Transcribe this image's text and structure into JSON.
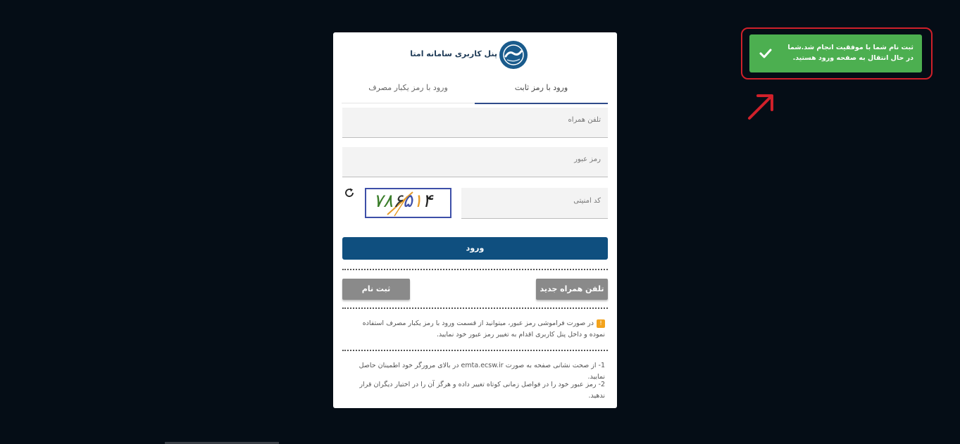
{
  "brand": {
    "title": "پنل کاربری سامانه امتا",
    "logo_icon": "emta-logo"
  },
  "tabs": [
    {
      "label": "ورود با رمز ثابت",
      "active": true
    },
    {
      "label": "ورود با رمز یکبار مصرف",
      "active": false
    }
  ],
  "form": {
    "phone_placeholder": "تلفن همراه",
    "password_placeholder": "رمز عبور",
    "captcha_placeholder": "کد امنیتی",
    "captcha_text": "۷۸۶۵۱۴",
    "refresh_icon": "refresh-icon",
    "login_label": "ورود"
  },
  "actions": {
    "new_phone_label": "تلفن همراه جدید",
    "register_label": "ثبت نام"
  },
  "notes": {
    "forgot_password": "در صورت فراموشی رمز عبور، میتوانید از قسمت ورود با رمز یکبار مصرف استفاده نموده و داخل پنل کاربری اقدام به تغییر رمز عبور خود نمایید.",
    "tip1": "1- از صحت نشانی صفحه به صورت emta.ecsw.ir در بالای مرورگر خود اطمینان حاصل نمایید.",
    "tip2": "2- رمز عبور خود را در فواصل زمانی کوتاه تغییر داده و هرگز آن را در اختیار دیگران قرار ندهید."
  },
  "toast": {
    "message": "ثبت نام شما با موفقیت انجام شد.شما در حال انتقال به صفحه ورود هستید.",
    "icon": "check-icon"
  },
  "colors": {
    "background": "#050d16",
    "primary": "#0f4f7f",
    "toast_green": "#4caf50",
    "highlight_red": "#d0202a",
    "warning": "#f3a31c"
  }
}
